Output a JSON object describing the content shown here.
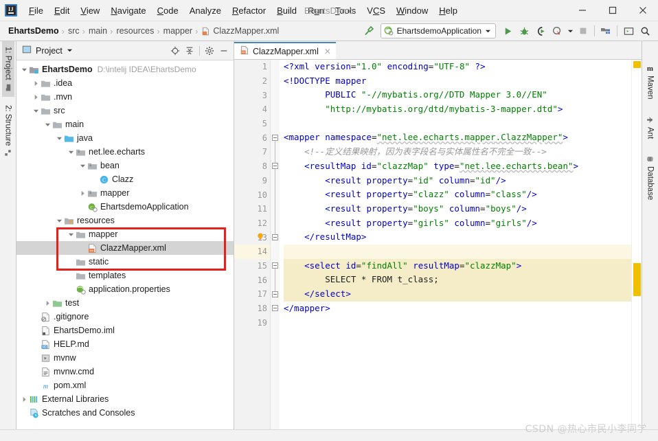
{
  "window": {
    "title": "EhartsDemo",
    "minimize_label": "Minimize",
    "maximize_label": "Maximize",
    "close_label": "Close"
  },
  "menubar": {
    "items": [
      {
        "label": "File",
        "mnemonic": "F"
      },
      {
        "label": "Edit",
        "mnemonic": "E"
      },
      {
        "label": "View",
        "mnemonic": "V"
      },
      {
        "label": "Navigate",
        "mnemonic": "N"
      },
      {
        "label": "Code",
        "mnemonic": "C"
      },
      {
        "label": "Analyze",
        "mnemonic": ""
      },
      {
        "label": "Refactor",
        "mnemonic": "R"
      },
      {
        "label": "Build",
        "mnemonic": "B"
      },
      {
        "label": "Run",
        "mnemonic": "u"
      },
      {
        "label": "Tools",
        "mnemonic": "T"
      },
      {
        "label": "VCS",
        "mnemonic": "C"
      },
      {
        "label": "Window",
        "mnemonic": "W"
      },
      {
        "label": "Help",
        "mnemonic": "H"
      }
    ]
  },
  "navbar": {
    "breadcrumbs": [
      "EhartsDemo",
      "src",
      "main",
      "resources",
      "mapper",
      "ClazzMapper.xml"
    ],
    "separator": "›",
    "run_config": "EhartsdemoApplication",
    "icons": [
      "hammer-build-icon",
      "run-icon",
      "debug-icon",
      "run-with-coverage-icon",
      "profiler-icon",
      "stop-icon",
      "project-structure-icon",
      "terminal-icon",
      "search-everywhere-icon"
    ]
  },
  "left_stripe": {
    "tabs": [
      {
        "label": "1: Project",
        "icon": "project-folder-icon",
        "active": true
      },
      {
        "label": "2: Structure",
        "icon": "structure-icon",
        "active": false
      }
    ]
  },
  "right_stripe": {
    "tabs": [
      {
        "label": "Maven",
        "icon": "maven-m-icon"
      },
      {
        "label": "Ant",
        "icon": "ant-bug-icon"
      },
      {
        "label": "Database",
        "icon": "database-icon"
      }
    ]
  },
  "project_panel": {
    "title": "Project",
    "view_dropdown": "▼",
    "toolbar_icons": [
      "locate-target-icon",
      "collapse-all-icon",
      "gear-icon",
      "hide-icon"
    ],
    "tree": [
      {
        "label": "EhartsDemo",
        "path": "D:\\intelij IDEA\\EhartsDemo",
        "indent": 0,
        "arrow": "down",
        "icon": "module-folder-icon",
        "bold": true
      },
      {
        "label": ".idea",
        "indent": 1,
        "arrow": "right",
        "icon": "folder-icon"
      },
      {
        "label": ".mvn",
        "indent": 1,
        "arrow": "right",
        "icon": "folder-icon"
      },
      {
        "label": "src",
        "indent": 1,
        "arrow": "down",
        "icon": "folder-icon"
      },
      {
        "label": "main",
        "indent": 2,
        "arrow": "down",
        "icon": "folder-icon"
      },
      {
        "label": "java",
        "indent": 3,
        "arrow": "down",
        "icon": "source-folder-icon"
      },
      {
        "label": "net.lee.echarts",
        "indent": 4,
        "arrow": "down",
        "icon": "package-icon"
      },
      {
        "label": "bean",
        "indent": 5,
        "arrow": "down",
        "icon": "package-icon"
      },
      {
        "label": "Clazz",
        "indent": 6,
        "arrow": "none",
        "icon": "java-class-icon"
      },
      {
        "label": "mapper",
        "indent": 5,
        "arrow": "right",
        "icon": "package-icon"
      },
      {
        "label": "EhartsdemoApplication",
        "indent": 5,
        "arrow": "none",
        "icon": "spring-class-icon"
      },
      {
        "label": "resources",
        "indent": 3,
        "arrow": "down",
        "icon": "resources-folder-icon"
      },
      {
        "label": "mapper",
        "indent": 4,
        "arrow": "down",
        "icon": "folder-icon"
      },
      {
        "label": "ClazzMapper.xml",
        "indent": 5,
        "arrow": "none",
        "icon": "xml-file-icon",
        "selected": true
      },
      {
        "label": "static",
        "indent": 4,
        "arrow": "none",
        "icon": "folder-icon"
      },
      {
        "label": "templates",
        "indent": 4,
        "arrow": "none",
        "icon": "folder-icon"
      },
      {
        "label": "application.properties",
        "indent": 4,
        "arrow": "none",
        "icon": "spring-properties-icon"
      },
      {
        "label": "test",
        "indent": 2,
        "arrow": "right",
        "icon": "test-folder-icon"
      },
      {
        "label": ".gitignore",
        "indent": 1,
        "arrow": "none",
        "icon": "gitignore-file-icon"
      },
      {
        "label": "EhartsDemo.iml",
        "indent": 1,
        "arrow": "none",
        "icon": "iml-file-icon"
      },
      {
        "label": "HELP.md",
        "indent": 1,
        "arrow": "none",
        "icon": "markdown-file-icon"
      },
      {
        "label": "mvnw",
        "indent": 1,
        "arrow": "none",
        "icon": "script-file-icon"
      },
      {
        "label": "mvnw.cmd",
        "indent": 1,
        "arrow": "none",
        "icon": "cmd-file-icon"
      },
      {
        "label": "pom.xml",
        "indent": 1,
        "arrow": "none",
        "icon": "maven-pom-icon"
      },
      {
        "label": "External Libraries",
        "indent": 0,
        "arrow": "right",
        "icon": "libraries-icon"
      },
      {
        "label": "Scratches and Consoles",
        "indent": 0,
        "arrow": "none",
        "icon": "scratches-icon"
      }
    ],
    "highlight_annotation": {
      "color": "#e8201b",
      "note": "red-box-around-resources-mapper-clazzmapper"
    }
  },
  "editor": {
    "tabs": [
      {
        "label": "ClazzMapper.xml",
        "icon": "xml-file-icon",
        "active": true,
        "close": "✕"
      }
    ],
    "line_numbers": [
      1,
      2,
      3,
      4,
      5,
      6,
      7,
      8,
      9,
      10,
      11,
      12,
      13,
      14,
      15,
      16,
      17,
      18,
      19
    ],
    "caret_line": 14,
    "warning_lines": [
      15,
      16,
      17
    ],
    "lines": [
      {
        "n": 1,
        "segments": [
          {
            "t": "<?",
            "c": "tag"
          },
          {
            "t": "xml",
            "c": "tag"
          },
          {
            "t": " ",
            "c": "txt"
          },
          {
            "t": "version",
            "c": "attr"
          },
          {
            "t": "=",
            "c": "txt"
          },
          {
            "t": "\"1.0\"",
            "c": "val"
          },
          {
            "t": " ",
            "c": "txt"
          },
          {
            "t": "encoding",
            "c": "attr"
          },
          {
            "t": "=",
            "c": "txt"
          },
          {
            "t": "\"UTF-8\"",
            "c": "val"
          },
          {
            "t": " ",
            "c": "txt"
          },
          {
            "t": "?>",
            "c": "tag"
          }
        ]
      },
      {
        "n": 2,
        "segments": [
          {
            "t": "<!DOCTYPE",
            "c": "tag"
          },
          {
            "t": " ",
            "c": "txt"
          },
          {
            "t": "mapper",
            "c": "tag"
          }
        ]
      },
      {
        "n": 3,
        "segments": [
          {
            "t": "        ",
            "c": "txt"
          },
          {
            "t": "PUBLIC",
            "c": "tag"
          },
          {
            "t": " ",
            "c": "txt"
          },
          {
            "t": "\"-//mybatis.org//DTD Mapper 3.0//EN\"",
            "c": "val"
          }
        ]
      },
      {
        "n": 4,
        "segments": [
          {
            "t": "        ",
            "c": "txt"
          },
          {
            "t": "\"http://mybatis.org/dtd/mybatis-3-mapper.dtd\"",
            "c": "val"
          },
          {
            "t": ">",
            "c": "tag"
          }
        ]
      },
      {
        "n": 5,
        "segments": []
      },
      {
        "n": 6,
        "segments": [
          {
            "t": "<mapper",
            "c": "tag"
          },
          {
            "t": " ",
            "c": "txt"
          },
          {
            "t": "namespace",
            "c": "attr"
          },
          {
            "t": "=",
            "c": "txt"
          },
          {
            "t": "\"net.lee.echarts.mapper.ClazzMapper\"",
            "c": "val wavy"
          },
          {
            "t": ">",
            "c": "tag"
          }
        ]
      },
      {
        "n": 7,
        "segments": [
          {
            "t": "    ",
            "c": "txt"
          },
          {
            "t": "<!--定义结果映射，因为表字段名与实体属性名不完全一致-->",
            "c": "cmt"
          }
        ]
      },
      {
        "n": 8,
        "segments": [
          {
            "t": "    ",
            "c": "txt"
          },
          {
            "t": "<resultMap",
            "c": "tag"
          },
          {
            "t": " ",
            "c": "txt"
          },
          {
            "t": "id",
            "c": "attr"
          },
          {
            "t": "=",
            "c": "txt"
          },
          {
            "t": "\"clazzMap\"",
            "c": "val"
          },
          {
            "t": " ",
            "c": "txt"
          },
          {
            "t": "type",
            "c": "attr"
          },
          {
            "t": "=",
            "c": "txt"
          },
          {
            "t": "\"net.lee.echarts.bean\"",
            "c": "val wavy"
          },
          {
            "t": ">",
            "c": "tag"
          }
        ]
      },
      {
        "n": 9,
        "segments": [
          {
            "t": "        ",
            "c": "txt"
          },
          {
            "t": "<result",
            "c": "tag"
          },
          {
            "t": " ",
            "c": "txt"
          },
          {
            "t": "property",
            "c": "attr"
          },
          {
            "t": "=",
            "c": "txt"
          },
          {
            "t": "\"id\"",
            "c": "val"
          },
          {
            "t": " ",
            "c": "txt"
          },
          {
            "t": "column",
            "c": "attr"
          },
          {
            "t": "=",
            "c": "txt"
          },
          {
            "t": "\"id\"",
            "c": "val"
          },
          {
            "t": "/>",
            "c": "tag"
          }
        ]
      },
      {
        "n": 10,
        "segments": [
          {
            "t": "        ",
            "c": "txt"
          },
          {
            "t": "<result",
            "c": "tag"
          },
          {
            "t": " ",
            "c": "txt"
          },
          {
            "t": "property",
            "c": "attr"
          },
          {
            "t": "=",
            "c": "txt"
          },
          {
            "t": "\"clazz\"",
            "c": "val"
          },
          {
            "t": " ",
            "c": "txt"
          },
          {
            "t": "column",
            "c": "attr"
          },
          {
            "t": "=",
            "c": "txt"
          },
          {
            "t": "\"class\"",
            "c": "val"
          },
          {
            "t": "/>",
            "c": "tag"
          }
        ]
      },
      {
        "n": 11,
        "segments": [
          {
            "t": "        ",
            "c": "txt"
          },
          {
            "t": "<result",
            "c": "tag"
          },
          {
            "t": " ",
            "c": "txt"
          },
          {
            "t": "property",
            "c": "attr"
          },
          {
            "t": "=",
            "c": "txt"
          },
          {
            "t": "\"boys\"",
            "c": "val"
          },
          {
            "t": " ",
            "c": "txt"
          },
          {
            "t": "column",
            "c": "attr"
          },
          {
            "t": "=",
            "c": "txt"
          },
          {
            "t": "\"boys\"",
            "c": "val"
          },
          {
            "t": "/>",
            "c": "tag"
          }
        ]
      },
      {
        "n": 12,
        "segments": [
          {
            "t": "        ",
            "c": "txt"
          },
          {
            "t": "<result",
            "c": "tag"
          },
          {
            "t": " ",
            "c": "txt"
          },
          {
            "t": "property",
            "c": "attr"
          },
          {
            "t": "=",
            "c": "txt"
          },
          {
            "t": "\"girls\"",
            "c": "val"
          },
          {
            "t": " ",
            "c": "txt"
          },
          {
            "t": "column",
            "c": "attr"
          },
          {
            "t": "=",
            "c": "txt"
          },
          {
            "t": "\"girls\"",
            "c": "val"
          },
          {
            "t": "/>",
            "c": "tag"
          }
        ]
      },
      {
        "n": 13,
        "segments": [
          {
            "t": "    ",
            "c": "txt"
          },
          {
            "t": "</resultMap>",
            "c": "tag"
          }
        ]
      },
      {
        "n": 14,
        "segments": []
      },
      {
        "n": 15,
        "segments": [
          {
            "t": "    ",
            "c": "txt"
          },
          {
            "t": "<select",
            "c": "tag"
          },
          {
            "t": " ",
            "c": "txt"
          },
          {
            "t": "id",
            "c": "attr"
          },
          {
            "t": "=",
            "c": "txt"
          },
          {
            "t": "\"findAll\"",
            "c": "val"
          },
          {
            "t": " ",
            "c": "txt"
          },
          {
            "t": "resultMap",
            "c": "attr"
          },
          {
            "t": "=",
            "c": "txt"
          },
          {
            "t": "\"clazzMap\"",
            "c": "val"
          },
          {
            "t": ">",
            "c": "tag"
          }
        ]
      },
      {
        "n": 16,
        "segments": [
          {
            "t": "        SELECT * FROM t_class;",
            "c": "txt"
          }
        ]
      },
      {
        "n": 17,
        "segments": [
          {
            "t": "    ",
            "c": "txt"
          },
          {
            "t": "</select>",
            "c": "tag"
          }
        ]
      },
      {
        "n": 18,
        "segments": [
          {
            "t": "</mapper>",
            "c": "tag"
          }
        ]
      },
      {
        "n": 19,
        "segments": []
      }
    ],
    "gutter_icons": [
      {
        "line": 13,
        "icon": "intention-bulb-icon"
      }
    ],
    "fold_markers": [
      6,
      8,
      13,
      15,
      17,
      18
    ],
    "error_stripes": [
      {
        "top_pct": 0,
        "color": "#f0c000",
        "name": "warning-stripe-top"
      },
      {
        "top_pct": 74,
        "color": "#f0c000",
        "name": "warning-stripe-select"
      }
    ]
  },
  "watermark": {
    "text": "CSDN @热心市民小李同学"
  },
  "colors": {
    "accent_blue": "#4286c4",
    "highlight_red": "#e8201b",
    "tag_blue": "#0000c8",
    "string_green": "#008000",
    "selection_gray": "#d4d4d4",
    "caret_line": "#fcf7e2",
    "warning_bg": "#f5edc8",
    "stripe_yellow": "#f0c000"
  }
}
